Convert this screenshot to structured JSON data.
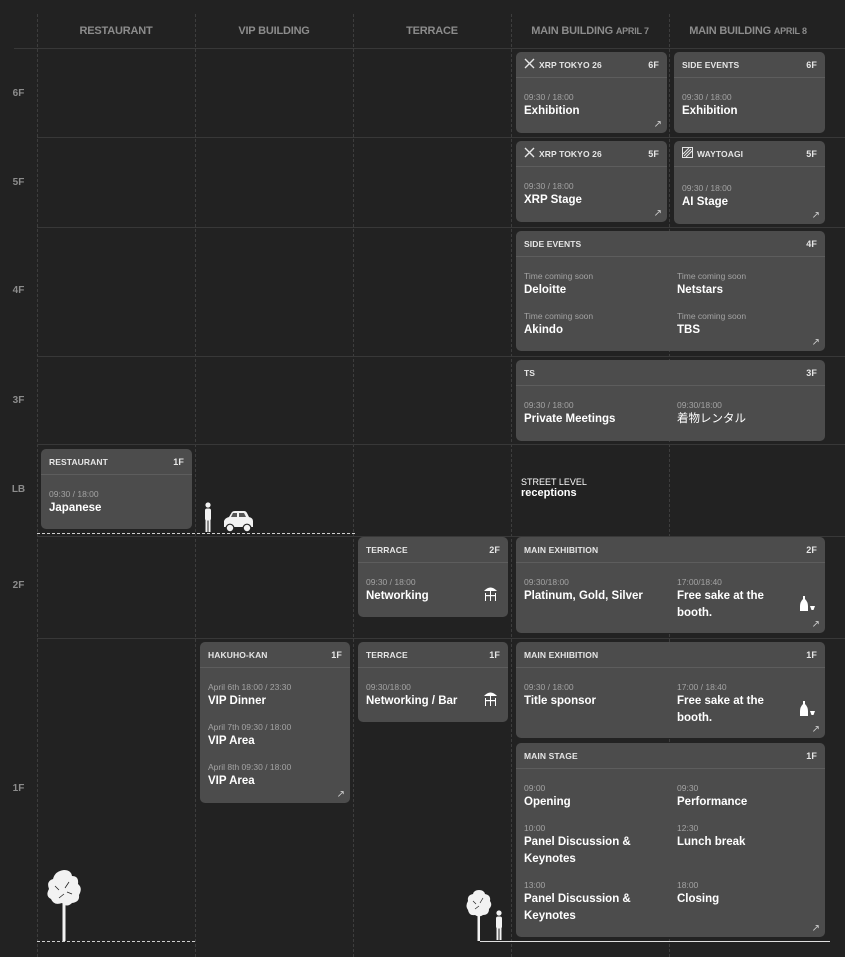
{
  "columns": [
    {
      "name": "RESTAURANT",
      "sub": ""
    },
    {
      "name": "VIP BUILDING",
      "sub": ""
    },
    {
      "name": "TERRACE",
      "sub": ""
    },
    {
      "name": "MAIN BUILDING",
      "sub": "APRIL 7"
    },
    {
      "name": "MAIN BUILDING",
      "sub": "APRIL 8"
    }
  ],
  "floors": [
    "6F",
    "5F",
    "4F",
    "3F",
    "LB",
    "2F",
    "1F"
  ],
  "street": {
    "prefix": "STREET LEVEL",
    "label": "receptions"
  },
  "arrow_glyph": "↗",
  "cards": {
    "xrp6": {
      "title": "XRP TOKYO 26",
      "floor": "6F",
      "events": [
        {
          "time": "09:30 / 18:00",
          "name": "Exhibition"
        }
      ]
    },
    "side6": {
      "title": "SIDE EVENTS",
      "floor": "6F",
      "events": [
        {
          "time": "09:30 / 18:00",
          "name": "Exhibition"
        }
      ]
    },
    "xrp5": {
      "title": "XRP TOKYO 26",
      "floor": "5F",
      "events": [
        {
          "time": "09:30 / 18:00",
          "name": "XRP Stage"
        }
      ]
    },
    "way5": {
      "title": "WAYTOAGI",
      "floor": "5F",
      "events": [
        {
          "time": "09:30 / 18:00",
          "name": "AI Stage"
        }
      ]
    },
    "side4": {
      "title": "SIDE EVENTS",
      "floor": "4F",
      "events": [
        {
          "time": "Time coming soon",
          "name": "Deloitte"
        },
        {
          "time": "Time coming soon",
          "name": "Netstars"
        },
        {
          "time": "Time coming soon",
          "name": "Akindo"
        },
        {
          "time": "Time coming soon",
          "name": "TBS"
        }
      ]
    },
    "ts3": {
      "title": "TS",
      "floor": "3F",
      "events": [
        {
          "time": "09:30 / 18:00",
          "name": "Private Meetings"
        },
        {
          "time": "09:30/18:00",
          "name": "着物レンタル"
        }
      ]
    },
    "rest": {
      "title": "RESTAURANT",
      "floor": "1F",
      "events": [
        {
          "time": "09:30 / 18:00",
          "name": "Japanese"
        }
      ]
    },
    "terr2": {
      "title": "TERRACE",
      "floor": "2F",
      "events": [
        {
          "time": "09:30 / 18:00",
          "name": "Networking"
        }
      ]
    },
    "mex2": {
      "title": "MAIN EXHIBITION",
      "floor": "2F",
      "events": [
        {
          "time": "09:30/18:00",
          "name": "Platinum, Gold, Silver"
        },
        {
          "time": "17:00/18:40",
          "name": "Free sake at the booth."
        }
      ]
    },
    "hak": {
      "title": "HAKUHO-KAN",
      "floor": "1F",
      "events": [
        {
          "time": "April 6th 18:00 / 23:30",
          "name": "VIP Dinner"
        },
        {
          "time": "April 7th 09:30 / 18:00",
          "name": "VIP Area"
        },
        {
          "time": "April 8th 09:30 / 18:00",
          "name": "VIP Area"
        }
      ]
    },
    "terr1": {
      "title": "TERRACE",
      "floor": "1F",
      "events": [
        {
          "time": "09:30/18:00",
          "name": "Networking / Bar"
        }
      ]
    },
    "mex1": {
      "title": "MAIN EXHIBITION",
      "floor": "1F",
      "events": [
        {
          "time": "09:30 / 18:00",
          "name": "Title sponsor"
        },
        {
          "time": "17:00 / 18:40",
          "name": "Free sake at the booth."
        }
      ]
    },
    "stage": {
      "title": "MAIN STAGE",
      "floor": "1F",
      "events": [
        {
          "time": "09:00",
          "name": "Opening"
        },
        {
          "time": "09:30",
          "name": "Performance"
        },
        {
          "time": "10:00",
          "name": "Panel Discussion & Keynotes"
        },
        {
          "time": "12:30",
          "name": "Lunch break"
        },
        {
          "time": "13:00",
          "name": "Panel Discussion & Keynotes"
        },
        {
          "time": "18:00",
          "name": "Closing"
        }
      ]
    }
  }
}
